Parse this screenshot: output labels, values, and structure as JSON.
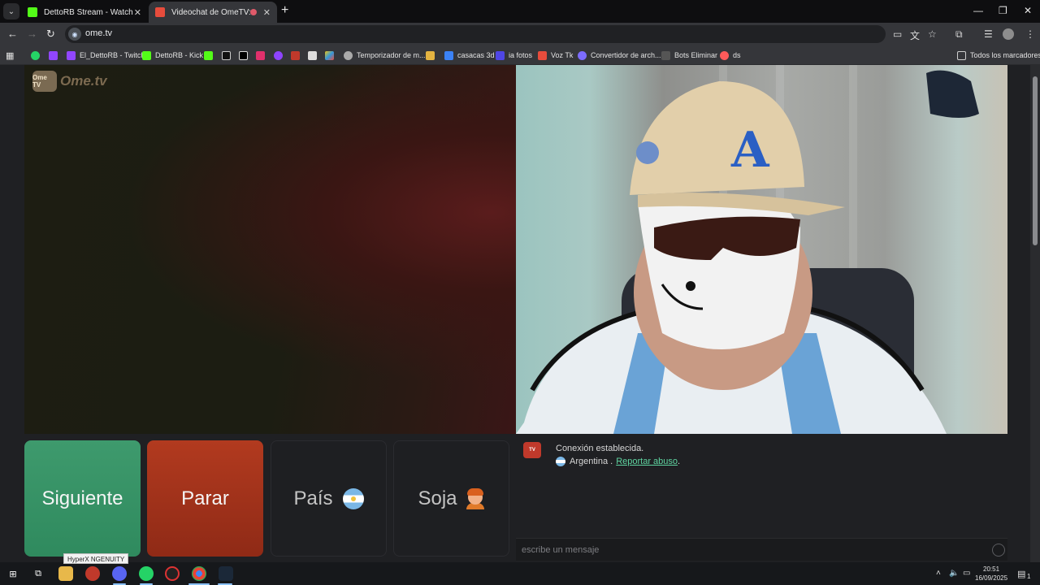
{
  "browser": {
    "tabs": [
      {
        "title": "DettoRB Stream - Watch Live o",
        "favicon_color": "#53fc18",
        "active": false
      },
      {
        "title": "Videochat de OmeTV: una",
        "favicon_color": "#e74c3c",
        "active": true
      }
    ],
    "url": "ome.tv",
    "bookmarks": [
      {
        "label": "",
        "icon_color": "#25d366"
      },
      {
        "label": "",
        "icon_color": "#9146ff"
      },
      {
        "label": "El_DettoRB - Twitch",
        "icon_color": "#9146ff"
      },
      {
        "label": "DettoRB - Kick",
        "icon_color": "#53fc18"
      },
      {
        "label": "",
        "icon_color": "#53fc18"
      },
      {
        "label": "",
        "icon_color": "#ffffff"
      },
      {
        "label": "",
        "icon_color": "#ffffff"
      },
      {
        "label": "",
        "icon_color": "#e1306c"
      },
      {
        "label": "",
        "icon_color": "#8e44ff"
      },
      {
        "label": "",
        "icon_color": "#c0392b"
      },
      {
        "label": "",
        "icon_color": "#dddddd"
      },
      {
        "label": "",
        "icon_color": "#f1c40f"
      },
      {
        "label": "Temporizador de m...",
        "icon_color": "#aaaaaa"
      },
      {
        "label": "",
        "icon_color": "#e3b341"
      },
      {
        "label": "casacas 3d",
        "icon_color": "#3b82f6"
      },
      {
        "label": "ia fotos",
        "icon_color": "#4f46e5"
      },
      {
        "label": "Voz Tk",
        "icon_color": "#e74c3c"
      },
      {
        "label": "Convertidor de arch...",
        "icon_color": "#7c6cff"
      },
      {
        "label": "Bots Eliminar",
        "icon_color": "#555555"
      },
      {
        "label": "ds",
        "icon_color": "#ff5a5a"
      }
    ],
    "all_bookmarks": "Todos los marcadores"
  },
  "page": {
    "logo_text": "Ome.tv",
    "logo_badge": "Ome TV",
    "buttons": {
      "next": "Siguiente",
      "stop": "Parar",
      "country": "País",
      "gender": "Soja"
    },
    "chat": {
      "message1": "Conexión establecida.",
      "country": "Argentina .",
      "report": "Reportar abuso",
      "report_suffix": ".",
      "input_placeholder": "escribe un mensaje"
    }
  },
  "taskbar": {
    "tooltip": "HyperX NGENUITY",
    "time": "20:51",
    "date": "16/09/2025",
    "notification_count": "1"
  }
}
